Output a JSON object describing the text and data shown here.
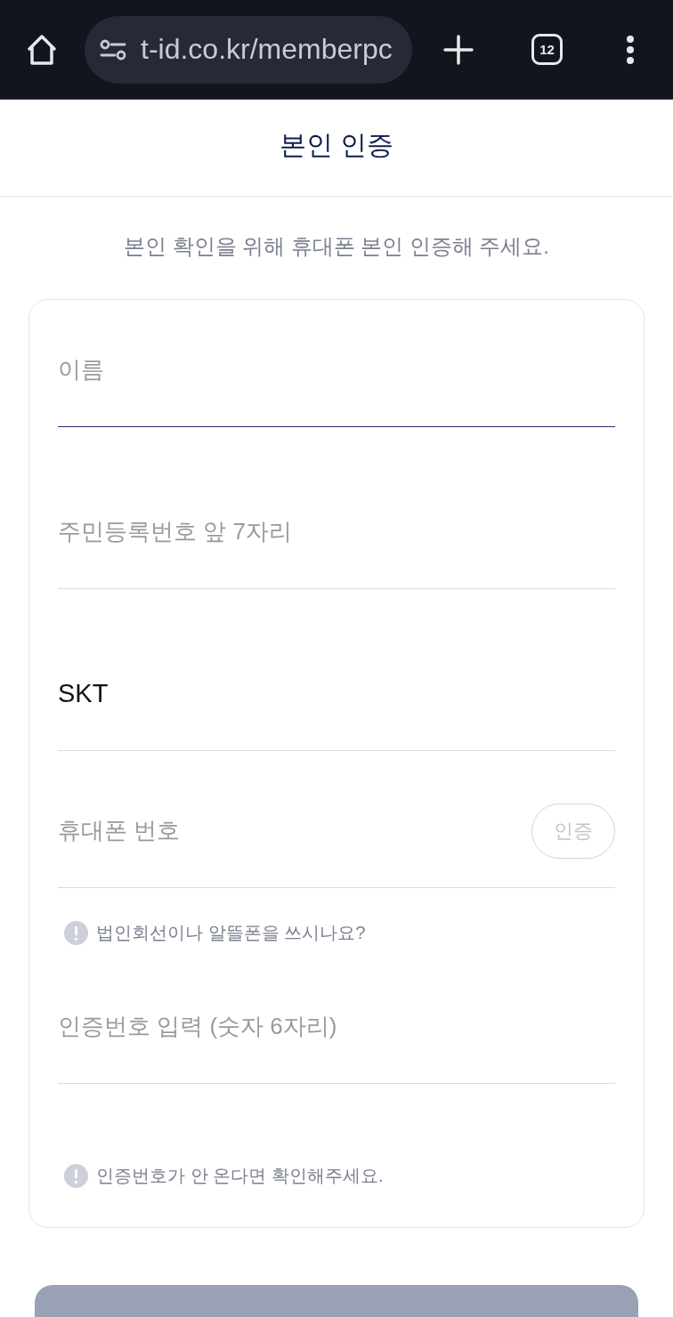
{
  "browser_bar": {
    "url": "t-id.co.kr/memberpc",
    "tab_count": "12"
  },
  "header": {
    "title": "본인 인증"
  },
  "intro": {
    "text": "본인 확인을 위해 휴대폰 본인 인증해 주세요."
  },
  "form": {
    "items": [
      {
        "kind": "input",
        "placeholder": "이름",
        "focused": true
      },
      {
        "kind": "input",
        "placeholder": "주민등록번호 앞 7자리",
        "focused": false
      },
      {
        "kind": "select",
        "value": "SKT",
        "focused": false
      },
      {
        "kind": "input_with_button",
        "placeholder": "휴대폰 번호",
        "focused": false,
        "button": {
          "label": "인증",
          "disabled": true
        }
      },
      {
        "kind": "note",
        "text": "법인회선이나 알뜰폰을 쓰시나요?"
      },
      {
        "kind": "input",
        "placeholder": "인증번호 입력 (숫자 6자리)",
        "focused": false
      },
      {
        "kind": "note",
        "text": "인증번호가 안 온다면 확인해주세요."
      }
    ]
  },
  "bottom_button": {
    "disabled": true
  }
}
